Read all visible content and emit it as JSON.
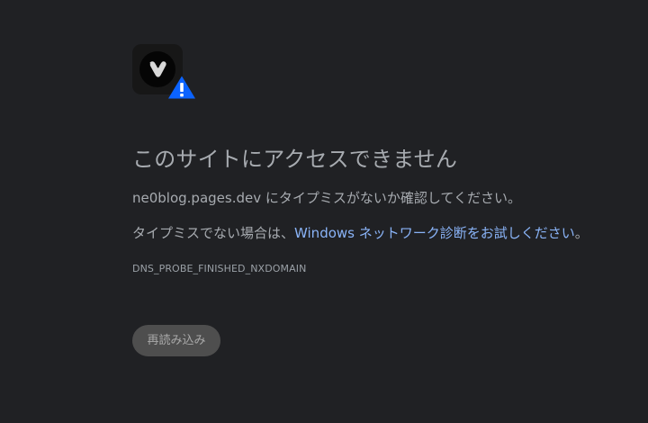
{
  "error_page": {
    "icons": {
      "browser_logo": "vivaldi-logo-icon",
      "warning": "warning-icon"
    },
    "title": "このサイトにアクセスできません",
    "message_domain_line": "ne0blog.pages.dev にタイプミスがないか確認してください。",
    "message_check_prefix": "タイプミスでない場合は、",
    "diagnostics_link_text": "Windows ネットワーク診断をお試しください",
    "message_check_suffix": "。",
    "error_code": "DNS_PROBE_FINISHED_NXDOMAIN",
    "reload_button": "再読み込み"
  },
  "colors": {
    "background": "#202124",
    "text": "#a7abb0",
    "link": "#8ab4f8",
    "warning": "#0b63ff",
    "button_background": "#4e4e4e"
  }
}
